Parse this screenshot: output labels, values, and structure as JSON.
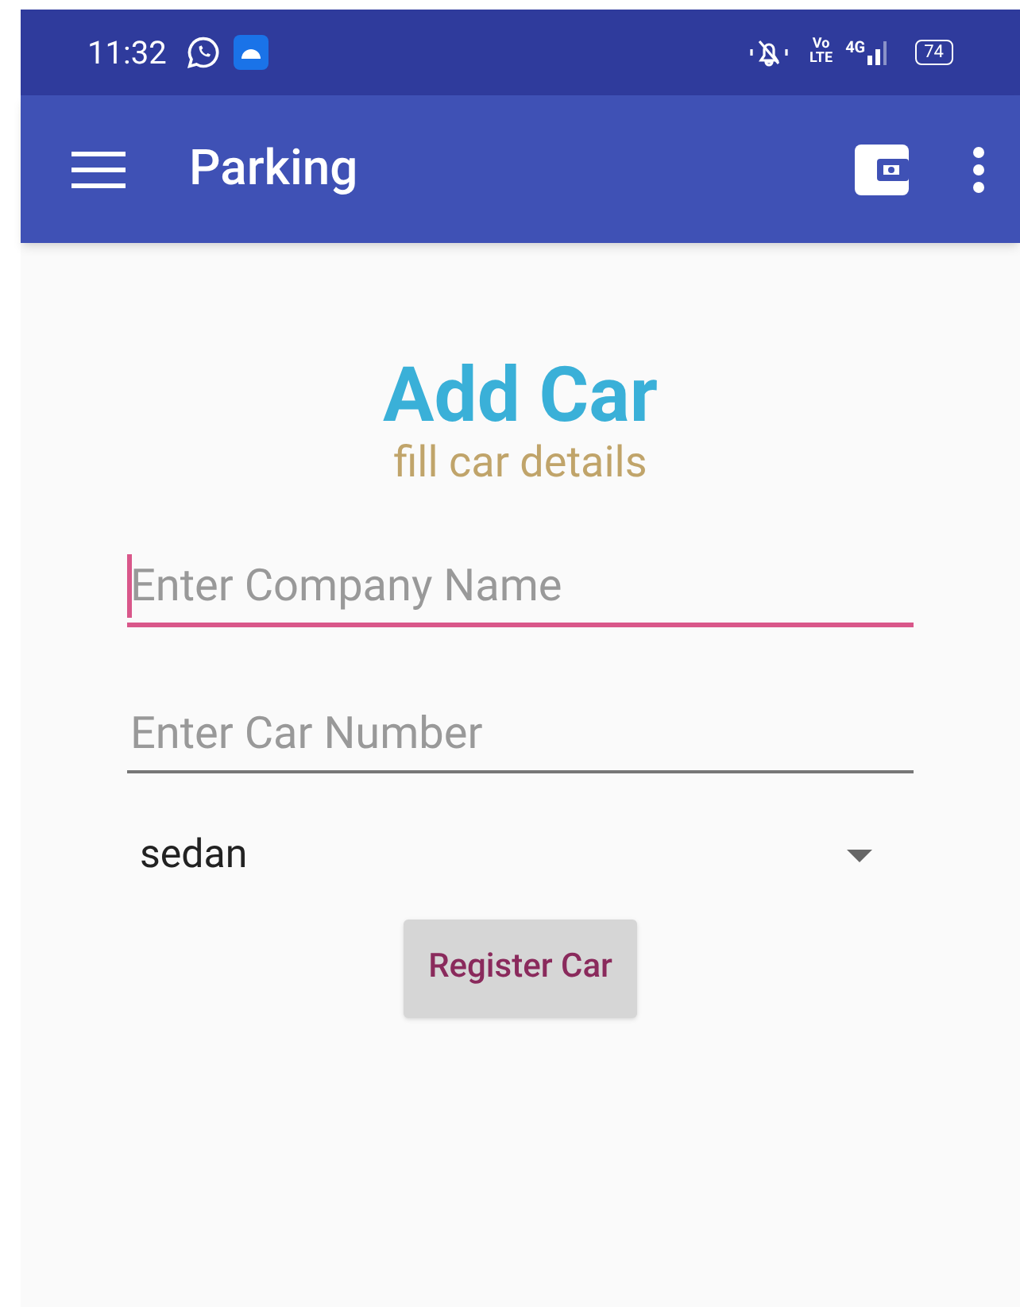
{
  "status_bar": {
    "time": "11:32",
    "volte_top": "Vo",
    "volte_bottom": "LTE",
    "network": "4G",
    "battery": "74"
  },
  "toolbar": {
    "title": "Parking"
  },
  "form": {
    "title": "Add Car",
    "subtitle": "fill car details",
    "fields": [
      {
        "placeholder": "Enter Company Name",
        "focused": true
      },
      {
        "placeholder": "Enter Car Number",
        "focused": false
      }
    ],
    "dropdown": {
      "value": "sedan"
    },
    "button": "Register Car"
  }
}
